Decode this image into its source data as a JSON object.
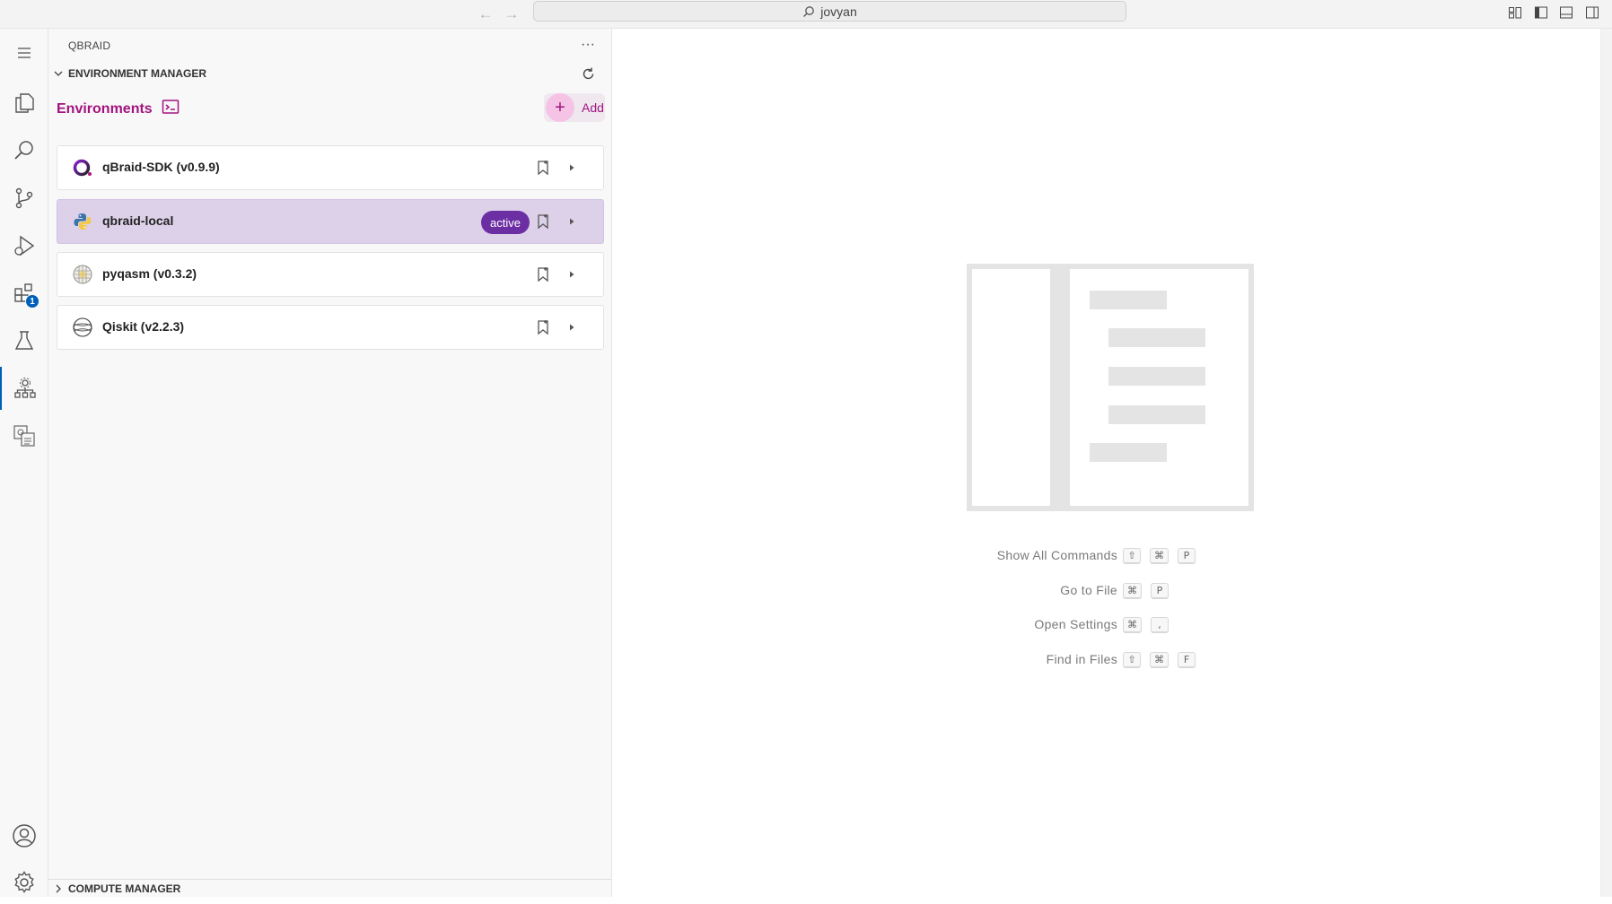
{
  "titlebar": {
    "search_text": "jovyan"
  },
  "activity_bar": {
    "items": [
      {
        "name": "menu-icon"
      },
      {
        "name": "explorer-icon"
      },
      {
        "name": "search-icon"
      },
      {
        "name": "source-control-icon"
      },
      {
        "name": "run-debug-icon"
      },
      {
        "name": "extensions-icon",
        "badge": "1"
      },
      {
        "name": "testing-icon"
      },
      {
        "name": "qbraid-environments-icon",
        "selected": true
      },
      {
        "name": "qbraid-quantum-icon"
      }
    ],
    "bottom": [
      "account-icon",
      "settings-gear-icon"
    ]
  },
  "sidebar": {
    "title": "QBRAID",
    "more_label": "···",
    "section_env": "ENVIRONMENT MANAGER",
    "environments_title": "Environments",
    "add_label": "Add",
    "environments": [
      {
        "name": "qBraid-SDK (v0.9.9)",
        "icon": "qbraid-logo-icon",
        "active": false
      },
      {
        "name": "qbraid-local",
        "icon": "python-icon",
        "active": true,
        "badge": "active"
      },
      {
        "name": "pyqasm (v0.3.2)",
        "icon": "pyqasm-icon",
        "active": false
      },
      {
        "name": "Qiskit (v2.2.3)",
        "icon": "globe-icon",
        "active": false
      }
    ],
    "section_compute": "COMPUTE MANAGER"
  },
  "editor": {
    "shortcuts": [
      {
        "label": "Show All Commands",
        "keys": [
          "⇧",
          "⌘",
          "P"
        ]
      },
      {
        "label": "Go to File",
        "keys": [
          "⌘",
          "P"
        ]
      },
      {
        "label": "Open Settings",
        "keys": [
          "⌘",
          ","
        ]
      },
      {
        "label": "Find in Files",
        "keys": [
          "⇧",
          "⌘",
          "F"
        ]
      }
    ]
  },
  "colors": {
    "accent": "#a3137e",
    "active_row": "#ddd1ea",
    "active_badge": "#6b2fa3",
    "activity_indicator": "#005fb8"
  }
}
